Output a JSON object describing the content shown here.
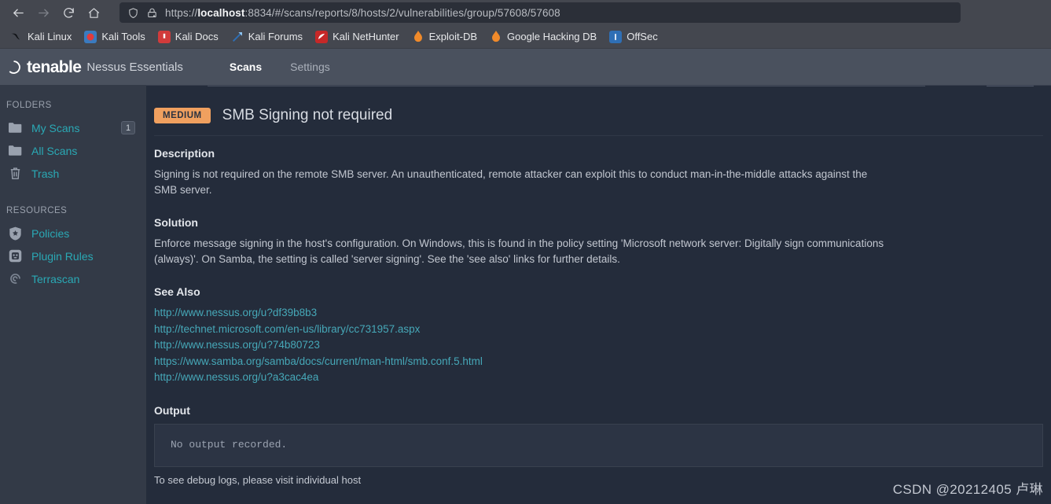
{
  "browser": {
    "nav": {
      "back": "back-arrow",
      "forward": "forward-arrow",
      "reload": "reload",
      "home": "home"
    },
    "url": {
      "scheme": "https://",
      "host": "localhost",
      "rest": ":8834/#/scans/reports/8/hosts/2/vulnerabilities/group/57608/57608",
      "full": "https://localhost:8834/#/scans/reports/8/hosts/2/vulnerabilities/group/57608/57608",
      "shield_icon": "shield-icon",
      "lock_icon": "lock-warning-icon"
    },
    "bookmarks": [
      {
        "label": "Kali Linux",
        "icon": "kali-dragon-icon",
        "color": "#1f2633",
        "glyph": "✒"
      },
      {
        "label": "Kali Tools",
        "icon": "kali-tools-icon",
        "color": "#3a7bbf",
        "glyph": "⚙"
      },
      {
        "label": "Kali Docs",
        "icon": "kali-docs-icon",
        "color": "#d13b3b",
        "glyph": "▤"
      },
      {
        "label": "Kali Forums",
        "icon": "kali-forums-icon",
        "color": "#2f6fb5",
        "glyph": "✉"
      },
      {
        "label": "Kali NetHunter",
        "icon": "kali-nethunter-icon",
        "color": "#c62828",
        "glyph": "◑"
      },
      {
        "label": "Exploit-DB",
        "icon": "exploit-db-icon",
        "color": "#1f2633",
        "glyph": "◆"
      },
      {
        "label": "Google Hacking DB",
        "icon": "google-hacking-db-icon",
        "color": "#1f2633",
        "glyph": "◆"
      },
      {
        "label": "OffSec",
        "icon": "offsec-icon",
        "color": "#2f6fb5",
        "glyph": "◐"
      }
    ]
  },
  "app": {
    "brand": "tenable",
    "product": "Nessus Essentials",
    "tabs": [
      {
        "label": "Scans",
        "active": true
      },
      {
        "label": "Settings",
        "active": false
      }
    ]
  },
  "sidebar": {
    "folders_heading": "FOLDERS",
    "folders": [
      {
        "label": "My Scans",
        "icon": "folder-icon",
        "badge": "1"
      },
      {
        "label": "All Scans",
        "icon": "folder-icon",
        "badge": ""
      },
      {
        "label": "Trash",
        "icon": "trash-icon",
        "badge": ""
      }
    ],
    "resources_heading": "RESOURCES",
    "resources": [
      {
        "label": "Policies",
        "icon": "shield-star-icon"
      },
      {
        "label": "Plugin Rules",
        "icon": "plugin-icon"
      },
      {
        "label": "Terrascan",
        "icon": "swirl-icon"
      }
    ]
  },
  "vulnerability": {
    "severity": "MEDIUM",
    "severity_color": "#f0a05f",
    "title": "SMB Signing not required",
    "description_heading": "Description",
    "description": "Signing is not required on the remote SMB server. An unauthenticated, remote attacker can exploit this to conduct man-in-the-middle attacks against the SMB server.",
    "solution_heading": "Solution",
    "solution": "Enforce message signing in the host's configuration. On Windows, this is found in the policy setting 'Microsoft network server: Digitally sign communications (always)'. On Samba, the setting is called 'server signing'. See the 'see also' links for further details.",
    "see_also_heading": "See Also",
    "see_also": [
      "http://www.nessus.org/u?df39b8b3",
      "http://technet.microsoft.com/en-us/library/cc731957.aspx",
      "http://www.nessus.org/u?74b80723",
      "https://www.samba.org/samba/docs/current/man-html/smb.conf.5.html",
      "http://www.nessus.org/u?a3cac4ea"
    ],
    "output_heading": "Output",
    "output_text": "No output recorded.",
    "output_note": "To see debug logs, please visit individual host"
  },
  "watermark": "CSDN @20212405 卢琳"
}
